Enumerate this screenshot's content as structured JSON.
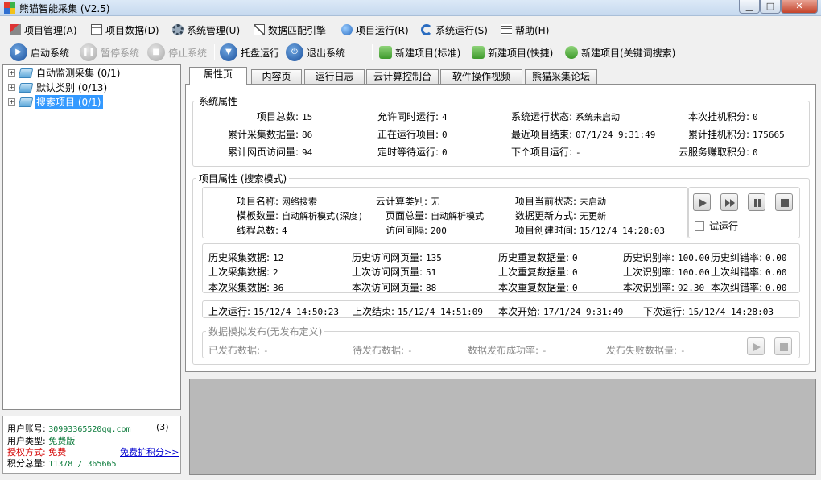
{
  "window": {
    "title": "熊猫智能采集  (V2.5)"
  },
  "menu": [
    "项目管理(A)",
    "项目数据(D)",
    "系统管理(U)",
    "数据匹配引擎",
    "项目运行(R)",
    "系统运行(S)",
    "帮助(H)"
  ],
  "toolbar": {
    "start": "启动系统",
    "pause": "暂停系统",
    "stop": "停止系统",
    "tray": "托盘运行",
    "exit": "退出系统",
    "new_standard": "新建项目(标准)",
    "new_quick": "新建项目(快捷)",
    "new_keyword": "新建项目(关键词搜索)"
  },
  "tree": [
    {
      "label": "自动监测采集 (0/1)"
    },
    {
      "label": "默认类别 (0/13)"
    },
    {
      "label": "搜索项目 (0/1)"
    }
  ],
  "user": {
    "account_label": "用户账号:",
    "account": "30993365520qq.com",
    "account_count": "(3)",
    "type_label": "用户类型:",
    "type": "免费版",
    "auth_label": "授权方式:",
    "auth": "免费",
    "points_label": "积分总量:",
    "points": "11378 / 365665",
    "expand_link": "免费扩积分>>"
  },
  "tabs": [
    "属性页",
    "内容页",
    "运行日志",
    "云计算控制台",
    "软件操作视频",
    "熊猫采集论坛"
  ],
  "system_attrs": {
    "title": "系统属性",
    "rows": [
      [
        {
          "k": "项目总数:",
          "v": "15"
        },
        {
          "k": "允许同时运行:",
          "v": "4"
        },
        {
          "k": "系统运行状态:",
          "v": "系统未启动"
        },
        {
          "k": "本次挂机积分:",
          "v": "0"
        }
      ],
      [
        {
          "k": "累计采集数据量:",
          "v": "86"
        },
        {
          "k": "正在运行项目:",
          "v": "0"
        },
        {
          "k": "最近项目结束:",
          "v": "07/1/24 9:31:49"
        },
        {
          "k": "累计挂机积分:",
          "v": "175665"
        }
      ],
      [
        {
          "k": "累计网页访问量:",
          "v": "94"
        },
        {
          "k": "定时等待运行:",
          "v": "0"
        },
        {
          "k": "下个项目运行:",
          "v": "-"
        },
        {
          "k": "云服务赚取积分:",
          "v": "0"
        }
      ]
    ]
  },
  "project_attrs": {
    "title": "项目属性 (搜索模式)",
    "info": [
      [
        {
          "k": "项目名称:",
          "v": "网络搜索"
        },
        {
          "k": "云计算类别:",
          "v": "无"
        },
        {
          "k": "项目当前状态:",
          "v": "未启动"
        }
      ],
      [
        {
          "k": "模板数量:",
          "v": "自动解析模式(深度)"
        },
        {
          "k": "页面总量:",
          "v": "自动解析模式"
        },
        {
          "k": "数据更新方式:",
          "v": "无更新"
        }
      ],
      [
        {
          "k": "线程总数:",
          "v": "4"
        },
        {
          "k": "访问间隔:",
          "v": "200"
        },
        {
          "k": "项目创建时间:",
          "v": "15/12/4 14:28:03"
        }
      ]
    ],
    "trial_run": "试运行",
    "stats": [
      [
        {
          "k": "历史采集数据:",
          "v": "12"
        },
        {
          "k": "历史访问网页量:",
          "v": "135"
        },
        {
          "k": "历史重复数据量:",
          "v": "0"
        },
        {
          "k": "历史识别率:",
          "v": "100.00"
        },
        {
          "k": "历史纠错率:",
          "v": "0.00"
        }
      ],
      [
        {
          "k": "上次采集数据:",
          "v": "2"
        },
        {
          "k": "上次访问网页量:",
          "v": "51"
        },
        {
          "k": "上次重复数据量:",
          "v": "0"
        },
        {
          "k": "上次识别率:",
          "v": "100.00"
        },
        {
          "k": "上次纠错率:",
          "v": "0.00"
        }
      ],
      [
        {
          "k": "本次采集数据:",
          "v": "36"
        },
        {
          "k": "本次访问网页量:",
          "v": "88"
        },
        {
          "k": "本次重复数据量:",
          "v": "0"
        },
        {
          "k": "本次识别率:",
          "v": "92.30"
        },
        {
          "k": "本次纠错率:",
          "v": "0.00"
        }
      ]
    ],
    "times": [
      {
        "k": "上次运行:",
        "v": "15/12/4 14:50:23"
      },
      {
        "k": "上次结束:",
        "v": "15/12/4 14:51:09"
      },
      {
        "k": "本次开始:",
        "v": "17/1/24 9:31:49"
      },
      {
        "k": "下次运行:",
        "v": "15/12/4 14:28:03"
      }
    ]
  },
  "publish": {
    "title": "数据模拟发布(无发布定义)",
    "items": [
      {
        "k": "已发布数据:",
        "v": "-"
      },
      {
        "k": "待发布数据:",
        "v": "-"
      },
      {
        "k": "数据发布成功率:",
        "v": "-"
      },
      {
        "k": "发布失败数据量:",
        "v": "-"
      }
    ]
  }
}
